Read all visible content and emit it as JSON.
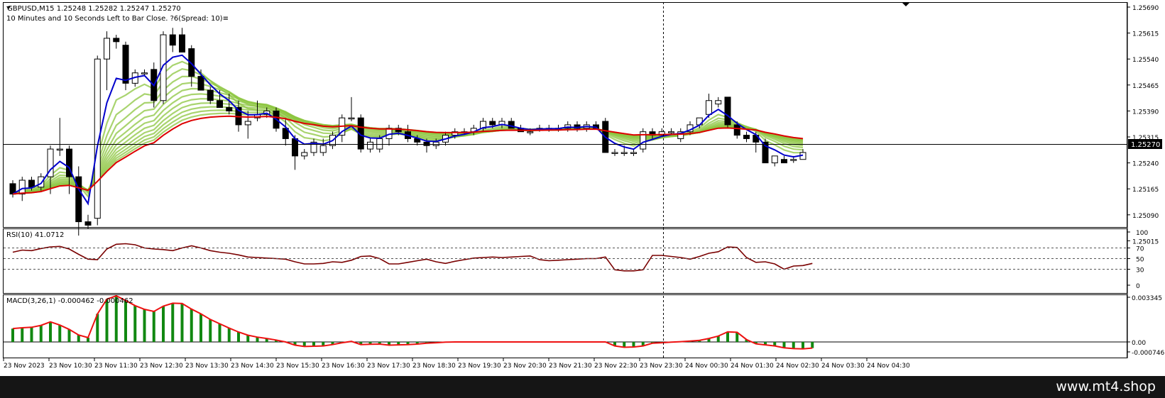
{
  "chart_header": {
    "symbol_line": "GBPUSD,M15  1.25248 1.25282 1.25247 1.25270",
    "info_line": "10 Minutes and 10 Seconds Left to Bar Close. ?6(Spread: 10)≡"
  },
  "main_axis": {
    "ticks": [
      "1.25690",
      "1.25615",
      "1.25540",
      "1.25465",
      "1.25390",
      "1.25315",
      "1.25240",
      "1.25165",
      "1.25090",
      "1.25015"
    ],
    "price_label": "1.25270"
  },
  "rsi_panel": {
    "label": "RSI(10) 41.0712",
    "ticks": [
      "100",
      "70",
      "50",
      "30",
      "0"
    ]
  },
  "macd_panel": {
    "label": "MACD(3,26,1) -0.000462 -0.000462",
    "ticks": [
      "0.003345",
      "0.00",
      "-0.000746"
    ]
  },
  "time_axis": {
    "labels": [
      "23 Nov 2023",
      "23 Nov 10:30",
      "23 Nov 11:30",
      "23 Nov 12:30",
      "23 Nov 13:30",
      "23 Nov 14:30",
      "23 Nov 15:30",
      "23 Nov 16:30",
      "23 Nov 17:30",
      "23 Nov 18:30",
      "23 Nov 19:30",
      "23 Nov 20:30",
      "23 Nov 21:30",
      "23 Nov 22:30",
      "23 Nov 23:30",
      "24 Nov 00:30",
      "24 Nov 01:30",
      "24 Nov 02:30",
      "24 Nov 03:30",
      "24 Nov 04:30"
    ]
  },
  "watermark": "www.mt4.shop",
  "colors": {
    "background": "#ffffff",
    "fast_ema": "#0000cc",
    "slow_ema": "#dd0000",
    "ribbon_green": "#8cc63f",
    "rsi_line": "#7a0000",
    "macd_bar": "#118811",
    "macd_signal": "#ee1111",
    "price_label_bg": "#000000",
    "footer_bg": "#151515"
  },
  "chart_data": [
    {
      "type": "candlestick",
      "title": "GBPUSD,M15",
      "ylim": [
        1.25,
        1.257
      ],
      "candles": [
        [
          1.2518,
          1.2519,
          1.2514,
          1.2515
        ],
        [
          1.2515,
          1.252,
          1.2513,
          1.2519
        ],
        [
          1.2519,
          1.252,
          1.2516,
          1.2517
        ],
        [
          1.2517,
          1.2521,
          1.2516,
          1.252
        ],
        [
          1.252,
          1.2529,
          1.2515,
          1.2528
        ],
        [
          1.2528,
          1.2537,
          1.2526,
          1.2528
        ],
        [
          1.2528,
          1.2529,
          1.2515,
          1.252
        ],
        [
          1.252,
          1.2523,
          1.2503,
          1.2507
        ],
        [
          1.2507,
          1.2509,
          1.2505,
          1.2506
        ],
        [
          1.2508,
          1.2555,
          1.2506,
          1.2554
        ],
        [
          1.2554,
          1.2562,
          1.2545,
          1.256
        ],
        [
          1.256,
          1.2561,
          1.2557,
          1.2559
        ],
        [
          1.2558,
          1.2559,
          1.2545,
          1.2547
        ],
        [
          1.2547,
          1.2551,
          1.2546,
          1.255
        ],
        [
          1.255,
          1.2551,
          1.2549,
          1.255
        ],
        [
          1.2551,
          1.2553,
          1.254,
          1.2542
        ],
        [
          1.2542,
          1.2562,
          1.2541,
          1.2561
        ],
        [
          1.2561,
          1.2563,
          1.2556,
          1.2558
        ],
        [
          1.2561,
          1.2563,
          1.2556,
          1.2556
        ],
        [
          1.2557,
          1.2558,
          1.2546,
          1.2549
        ],
        [
          1.2549,
          1.2551,
          1.2545,
          1.2545
        ],
        [
          1.2545,
          1.2546,
          1.2541,
          1.2542
        ],
        [
          1.2542,
          1.2545,
          1.254,
          1.254
        ],
        [
          1.254,
          1.2544,
          1.2538,
          1.2539
        ],
        [
          1.254,
          1.2542,
          1.2533,
          1.2535
        ],
        [
          1.2535,
          1.2539,
          1.2531,
          1.2536
        ],
        [
          1.2537,
          1.2542,
          1.2536,
          1.2538
        ],
        [
          1.2538,
          1.254,
          1.2537,
          1.2539
        ],
        [
          1.2539,
          1.254,
          1.2533,
          1.2534
        ],
        [
          1.2534,
          1.2537,
          1.2529,
          1.2531
        ],
        [
          1.2531,
          1.2532,
          1.2522,
          1.2526
        ],
        [
          1.2526,
          1.2528,
          1.2525,
          1.2527
        ],
        [
          1.2527,
          1.2531,
          1.2526,
          1.253
        ],
        [
          1.2527,
          1.2531,
          1.2526,
          1.2529
        ],
        [
          1.2529,
          1.2533,
          1.2528,
          1.2532
        ],
        [
          1.2532,
          1.2538,
          1.253,
          1.2537
        ],
        [
          1.2537,
          1.2543,
          1.2536,
          1.2537
        ],
        [
          1.2537,
          1.2538,
          1.2527,
          1.2528
        ],
        [
          1.2528,
          1.2531,
          1.2527,
          1.253
        ],
        [
          1.2528,
          1.2532,
          1.2527,
          1.2531
        ],
        [
          1.2531,
          1.2535,
          1.2529,
          1.2534
        ],
        [
          1.2534,
          1.2535,
          1.2532,
          1.2533
        ],
        [
          1.2533,
          1.2535,
          1.253,
          1.2531
        ],
        [
          1.2531,
          1.2532,
          1.2529,
          1.253
        ],
        [
          1.253,
          1.2531,
          1.2527,
          1.2529
        ],
        [
          1.2529,
          1.2531,
          1.2528,
          1.253
        ],
        [
          1.253,
          1.2533,
          1.2529,
          1.2532
        ],
        [
          1.2532,
          1.2534,
          1.2531,
          1.2533
        ],
        [
          1.2533,
          1.2534,
          1.2532,
          1.2533
        ],
        [
          1.2533,
          1.2535,
          1.2532,
          1.2534
        ],
        [
          1.2534,
          1.2537,
          1.2533,
          1.2536
        ],
        [
          1.2536,
          1.2537,
          1.2534,
          1.2535
        ],
        [
          1.2535,
          1.2537,
          1.2534,
          1.2536
        ],
        [
          1.2536,
          1.2537,
          1.2534,
          1.2534
        ],
        [
          1.2534,
          1.2535,
          1.2533,
          1.2533
        ],
        [
          1.2533,
          1.2534,
          1.2532,
          1.2533
        ],
        [
          1.2534,
          1.2535,
          1.2533,
          1.2534
        ],
        [
          1.2534,
          1.2535,
          1.2533,
          1.2534
        ],
        [
          1.2534,
          1.2535,
          1.2533,
          1.2534
        ],
        [
          1.2534,
          1.2536,
          1.2533,
          1.2535
        ],
        [
          1.2535,
          1.2536,
          1.2533,
          1.2534
        ],
        [
          1.2534,
          1.2536,
          1.2533,
          1.2535
        ],
        [
          1.2535,
          1.2536,
          1.2534,
          1.2534
        ],
        [
          1.2536,
          1.2537,
          1.2528,
          1.2527
        ],
        [
          1.2527,
          1.2528,
          1.2526,
          1.2527
        ],
        [
          1.2527,
          1.2529,
          1.2526,
          1.2527
        ],
        [
          1.2527,
          1.2528,
          1.2526,
          1.2527
        ],
        [
          1.2528,
          1.2534,
          1.2527,
          1.2533
        ],
        [
          1.2533,
          1.2534,
          1.2531,
          1.2532
        ],
        [
          1.2532,
          1.2534,
          1.2532,
          1.2533
        ],
        [
          1.2533,
          1.2534,
          1.2532,
          1.2533
        ],
        [
          1.2531,
          1.2534,
          1.253,
          1.2533
        ],
        [
          1.2533,
          1.2536,
          1.2532,
          1.2535
        ],
        [
          1.2535,
          1.2537,
          1.2534,
          1.2537
        ],
        [
          1.2538,
          1.2544,
          1.2537,
          1.2542
        ],
        [
          1.2541,
          1.2543,
          1.254,
          1.2542
        ],
        [
          1.2543,
          1.2543,
          1.2534,
          1.2535
        ],
        [
          1.2535,
          1.2536,
          1.2531,
          1.2532
        ],
        [
          1.2532,
          1.2533,
          1.253,
          1.2531
        ],
        [
          1.2532,
          1.2533,
          1.2527,
          1.253
        ],
        [
          1.253,
          1.2531,
          1.2524,
          1.2524
        ],
        [
          1.2524,
          1.2526,
          1.2523,
          1.2526
        ],
        [
          1.2525,
          1.2526,
          1.2524,
          1.2524
        ],
        [
          1.2525,
          1.2526,
          1.2524,
          1.2525
        ],
        [
          1.2525,
          1.2528,
          1.2525,
          1.2527
        ]
      ]
    },
    {
      "type": "line",
      "title": "RSI(10) 41.0712",
      "ylim": [
        0,
        100
      ],
      "levels": [
        30,
        50,
        70
      ],
      "values": [
        62,
        66,
        65,
        69,
        72,
        73,
        68,
        58,
        49,
        48,
        68,
        77,
        78,
        76,
        70,
        68,
        67,
        65,
        70,
        74,
        70,
        65,
        62,
        60,
        57,
        53,
        52,
        51,
        50,
        49,
        44,
        40,
        40,
        41,
        44,
        43,
        47,
        54,
        55,
        50,
        40,
        40,
        43,
        46,
        49,
        44,
        41,
        45,
        48,
        51,
        52,
        53,
        52,
        53,
        54,
        55,
        48,
        46,
        47,
        48,
        49,
        50,
        50,
        53,
        29,
        27,
        27,
        29,
        56,
        56,
        54,
        52,
        49,
        54,
        60,
        63,
        72,
        71,
        52,
        43,
        44,
        40,
        30,
        36,
        37,
        41
      ]
    },
    {
      "type": "bar",
      "title": "MACD(3,26,1) -0.000462 -0.000462",
      "ylim": [
        -0.000746,
        0.003345
      ],
      "values": [
        0.001,
        0.00106,
        0.0011,
        0.00124,
        0.0015,
        0.00126,
        0.00094,
        0.00052,
        0.00032,
        0.0021,
        0.0032,
        0.00345,
        0.0031,
        0.00272,
        0.00244,
        0.00228,
        0.00268,
        0.0029,
        0.00288,
        0.00246,
        0.0021,
        0.00168,
        0.00136,
        0.00104,
        0.00074,
        0.0005,
        0.00036,
        0.00026,
        0.00014,
        0.0,
        -0.00024,
        -0.00034,
        -0.00032,
        -0.0003,
        -0.0002,
        -6e-05,
        4e-05,
        -0.0002,
        -0.00018,
        -0.00016,
        -0.00024,
        -0.00022,
        -0.0002,
        -0.00016,
        -0.0001,
        -6e-05,
        -2e-05,
        0.0,
        0.0,
        0.0,
        0.0,
        0.0,
        0.0,
        0.0,
        0.0,
        0.0,
        0.0,
        0.0,
        0.0,
        0.0,
        0.0,
        0.0,
        0.0,
        0.0,
        -0.0003,
        -0.0004,
        -0.00038,
        -0.0003,
        -0.0001,
        -6e-05,
        -2e-05,
        2e-05,
        6e-05,
        0.00012,
        0.00026,
        0.00044,
        0.00076,
        0.00072,
        0.00018,
        -0.00014,
        -0.00022,
        -0.0003,
        -0.00044,
        -0.0005,
        -0.00052,
        -0.00046
      ]
    }
  ]
}
